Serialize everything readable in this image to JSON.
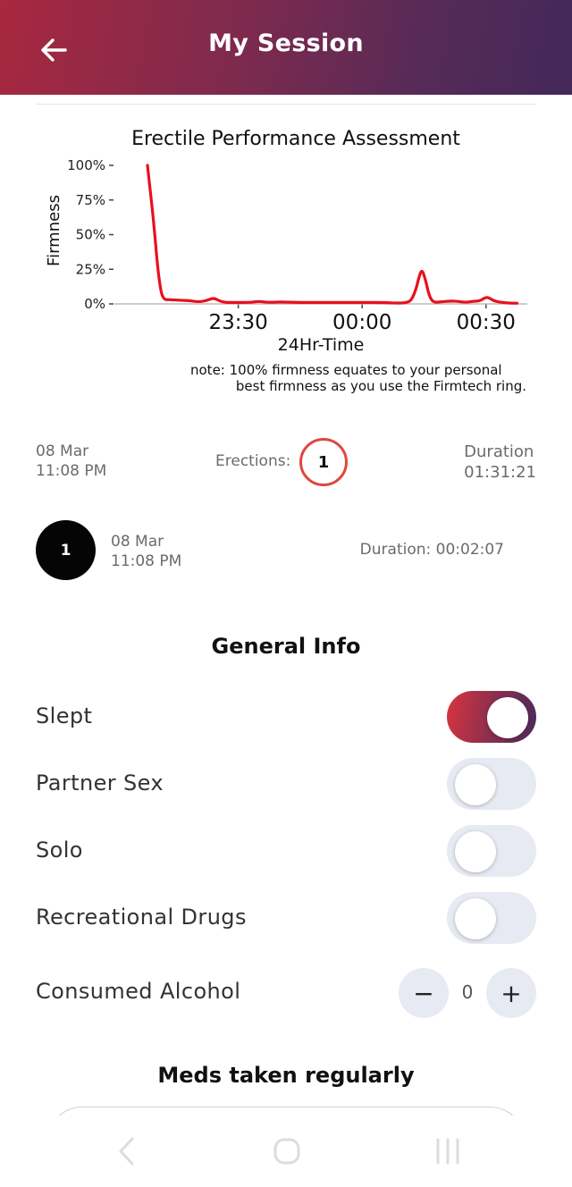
{
  "header": {
    "title": "My Session"
  },
  "chart_data": {
    "type": "line",
    "title": "Erectile Performance Assessment",
    "xlabel": "24Hr-Time",
    "ylabel": "Firmness",
    "yticks": [
      "100%",
      "75%",
      "50%",
      "25%",
      "0%"
    ],
    "ylim": [
      0,
      100
    ],
    "xticks": [
      {
        "label": "23:30",
        "minute": 30
      },
      {
        "label": "00:00",
        "minute": 60
      },
      {
        "label": "00:30",
        "minute": 90
      }
    ],
    "grid": false,
    "series": [
      {
        "color": "#e8101c",
        "x": [
          8,
          9.5,
          10.5,
          11.3,
          12,
          12.7,
          14,
          16,
          18,
          20,
          22,
          24,
          25.5,
          27,
          28,
          30,
          33,
          35,
          37,
          40,
          45,
          50,
          55,
          60,
          65,
          69,
          71,
          72,
          73,
          73.8,
          74.5,
          75.3,
          76.2,
          77.2,
          79,
          81,
          83,
          85,
          87,
          88.5,
          90,
          91,
          92,
          94,
          96,
          97.5
        ],
        "y": [
          100,
          60,
          25,
          8,
          3.5,
          3,
          3,
          2.5,
          2.5,
          1.5,
          2,
          4.5,
          2,
          1,
          1,
          1,
          1,
          2,
          1,
          1.5,
          1,
          1,
          1,
          1,
          1,
          0.5,
          1,
          3,
          10,
          20,
          25,
          18,
          6,
          1,
          1.5,
          2,
          2,
          1,
          2,
          2,
          5,
          4,
          2,
          1,
          0.5,
          0.5
        ]
      }
    ],
    "note": "note: 100% firmness equates to your personal",
    "note2": "best firmness as you use the Firmtech ring."
  },
  "summary": {
    "date": "08 Mar",
    "time": "11:08 PM",
    "erections_label": "Erections:",
    "erections_count": "1",
    "duration_label": "Duration",
    "duration_value": "01:31:21"
  },
  "session": {
    "number": "1",
    "date": "08 Mar",
    "time": "11:08 PM",
    "duration": "Duration: 00:02:07"
  },
  "general_info": {
    "title": "General Info",
    "options": [
      {
        "label": "Slept",
        "on": true
      },
      {
        "label": "Partner Sex",
        "on": false
      },
      {
        "label": "Solo",
        "on": false
      },
      {
        "label": "Recreational Drugs",
        "on": false
      }
    ],
    "alcohol": {
      "label": "Consumed Alcohol",
      "value": "0",
      "minus": "−",
      "plus": "+"
    }
  },
  "meds": {
    "title": "Meds taken regularly"
  },
  "colors": {
    "accent": "#e0473e",
    "line": "#e8101c",
    "toggle_off": "#e7eaf2"
  }
}
